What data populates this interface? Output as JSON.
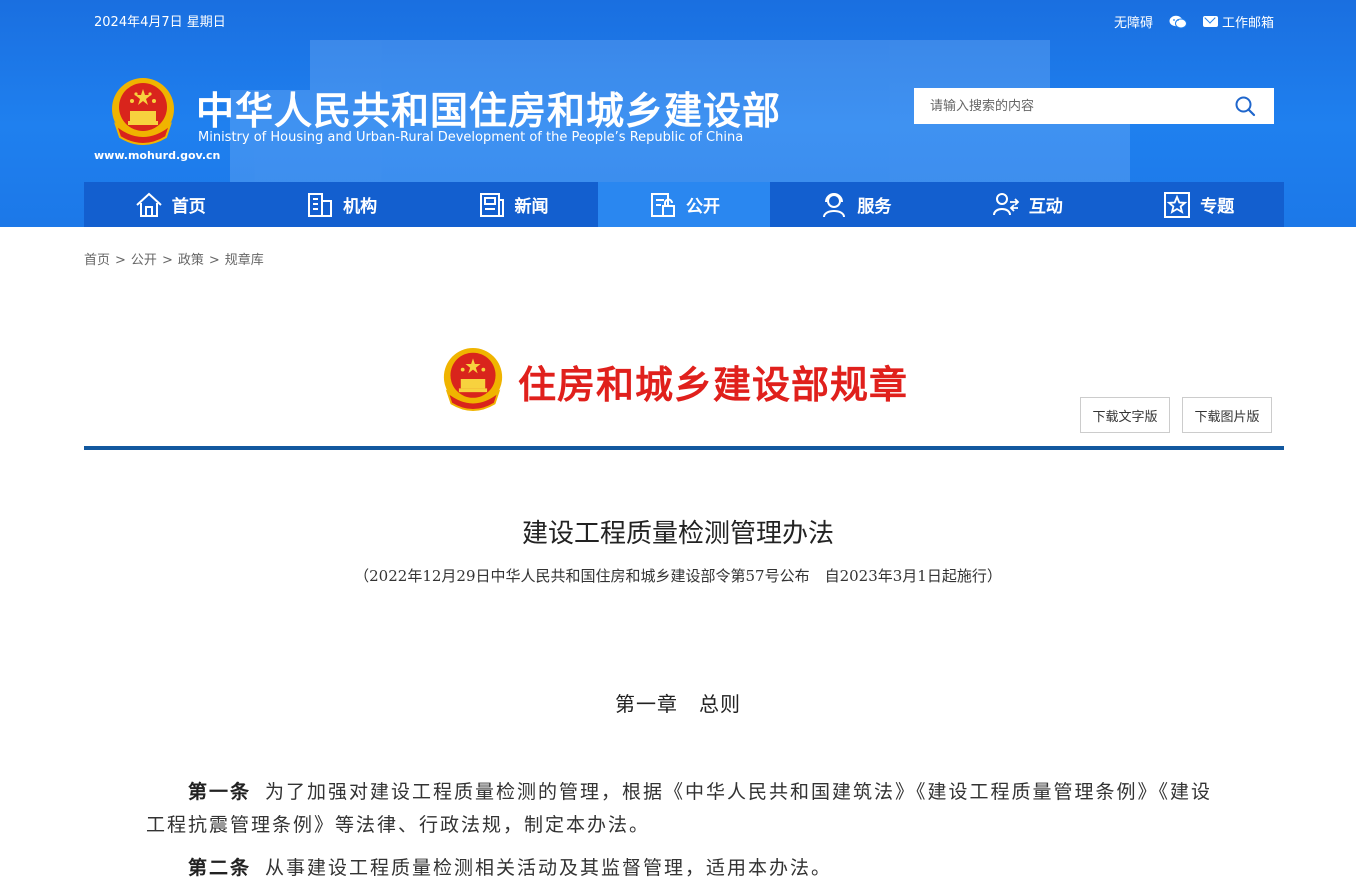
{
  "topbar": {
    "date": "2024年4月7日 星期日",
    "accessibility": "无障碍",
    "mail": "工作邮箱",
    "icons": [
      "wechat-icon",
      "mail-icon"
    ]
  },
  "site": {
    "title": "中华人民共和国住房和城乡建设部",
    "subtitle": "Ministry of Housing and Urban-Rural Development of the People’s Republic of China",
    "url": "www.mohurd.gov.cn"
  },
  "search": {
    "placeholder": "请输入搜索的内容",
    "value": ""
  },
  "nav": {
    "items": [
      {
        "label": "首页",
        "icon": "home-icon"
      },
      {
        "label": "机构",
        "icon": "building-icon"
      },
      {
        "label": "新闻",
        "icon": "news-icon"
      },
      {
        "label": "公开",
        "icon": "disclosure-icon",
        "active": true
      },
      {
        "label": "服务",
        "icon": "service-icon"
      },
      {
        "label": "互动",
        "icon": "interaction-icon"
      },
      {
        "label": "专题",
        "icon": "topic-star-icon"
      }
    ]
  },
  "breadcrumb": {
    "items": [
      "首页",
      "公开",
      "政策",
      "规章库"
    ],
    "separator": ">"
  },
  "regulation": {
    "banner_title": "住房和城乡建设部规章",
    "download_text": "下载文字版",
    "download_image": "下载图片版"
  },
  "document": {
    "title": "建设工程质量检测管理办法",
    "meta": "（2022年12月29日中华人民共和国住房和城乡建设部令第57号公布　自2023年3月1日起施行）",
    "chapter": "第一章　总则",
    "articles": [
      {
        "no": "第一条",
        "text": "为了加强对建设工程质量检测的管理，根据《中华人民共和国建筑法》《建设工程质量管理条例》《建设工程抗震管理条例》等法律、行政法规，制定本办法。"
      },
      {
        "no": "第二条",
        "text": "从事建设工程质量检测相关活动及其监督管理，适用本办法。"
      }
    ]
  },
  "colors": {
    "header_blue": "#1f80ef",
    "nav_blue": "#135fcf",
    "nav_active": "#2a87f0",
    "banner_red": "#e0201c",
    "divider_blue": "#12589f"
  }
}
